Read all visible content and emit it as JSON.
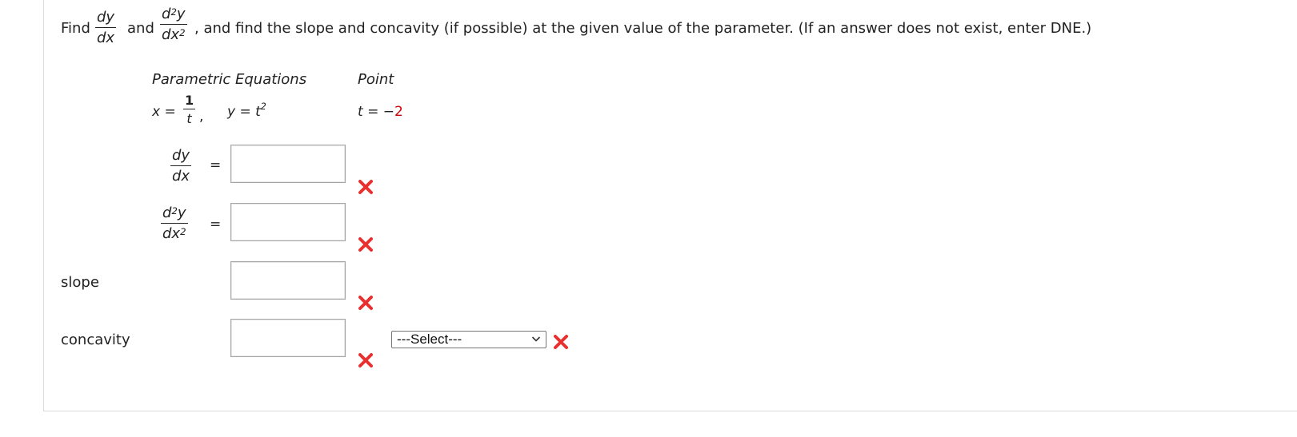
{
  "prompt": {
    "find_label": "Find",
    "dy": "dy",
    "dx": "dx",
    "and_label": "and",
    "d2y": "d",
    "d2y_y": "y",
    "d2x": "dx",
    "rest_text": ", and find the slope and concavity (if possible) at the given value of the parameter. (If an answer does not exist, enter DNE.)"
  },
  "headers": {
    "parametric": "Parametric Equations",
    "point": "Point"
  },
  "equations": {
    "x_lhs": "x =",
    "x_num": "1",
    "x_den": "t",
    "comma": ",",
    "y_eq": "y = t",
    "y_exp": "2"
  },
  "point": {
    "t_label": "t = −",
    "t_value": "2",
    "t_value_color": "#d40000"
  },
  "rows": {
    "first_derivative": {
      "num": "dy",
      "den": "dx",
      "eq": "=",
      "value": ""
    },
    "second_derivative": {
      "num": "d",
      "num_y": "y",
      "den": "dx",
      "eq": "=",
      "value": ""
    },
    "slope": {
      "label": "slope",
      "value": ""
    },
    "concavity": {
      "label": "concavity",
      "value": ""
    }
  },
  "concavity_select": {
    "selected": "---Select---"
  },
  "colors": {
    "incorrect_mark": "#e8302f"
  },
  "icons": {
    "incorrect": "x-mark-icon",
    "dropdown": "chevron-down-icon"
  }
}
